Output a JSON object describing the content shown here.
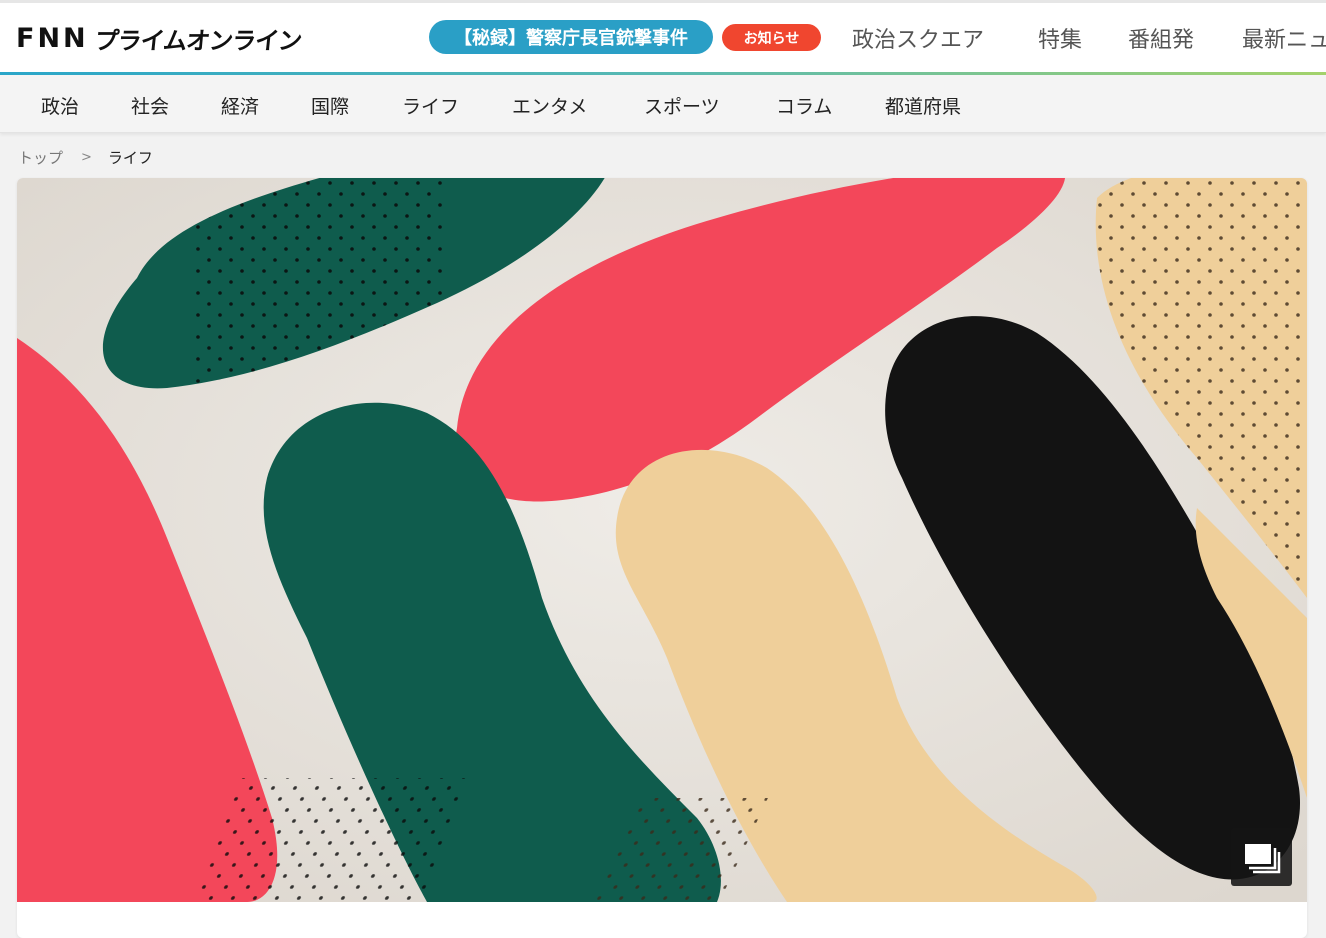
{
  "header": {
    "logo_main": "FNN",
    "logo_sub": "プライムオンライン",
    "featured_label": "【秘録】警察庁長官銃撃事件",
    "notice_label": "お知らせ",
    "nav": [
      "政治スクエア",
      "特集",
      "番組発",
      "最新ニュ"
    ]
  },
  "subnav": [
    "政治",
    "社会",
    "経済",
    "国際",
    "ライフ",
    "エンタメ",
    "スポーツ",
    "コラム",
    "都道府県"
  ],
  "breadcrumb": {
    "home": "トップ",
    "separator": ">",
    "current": "ライフ"
  },
  "hero": {
    "icons": {
      "gallery": "gallery-icon"
    }
  },
  "colors": {
    "accent_blue": "#2a9fc6",
    "notice_red": "#f0462f",
    "insole_red": "#f3475a",
    "insole_green": "#0f5c4d",
    "insole_beige": "#efcf9a",
    "insole_black": "#131313",
    "background": "#e9e5e0"
  }
}
